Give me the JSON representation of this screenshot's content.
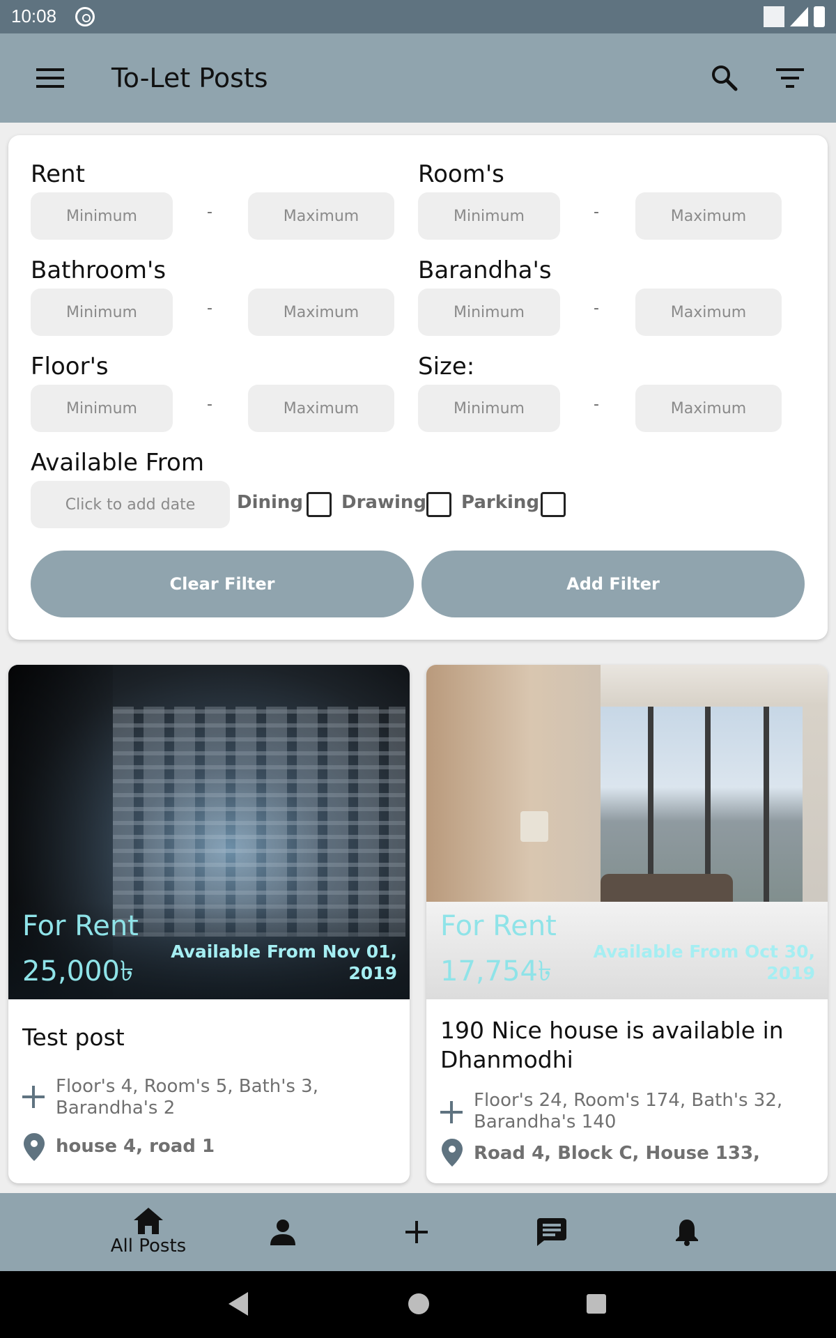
{
  "status_bar": {
    "time": "10:08"
  },
  "app_bar": {
    "title": "To-Let Posts",
    "icons": [
      "menu-icon",
      "search-icon",
      "filter-icon"
    ]
  },
  "filter": {
    "rent": {
      "label": "Rent",
      "min_placeholder": "Minimum",
      "max_placeholder": "Maximum"
    },
    "rooms": {
      "label": "Room's",
      "min_placeholder": "Minimum",
      "max_placeholder": "Maximum"
    },
    "bathrooms": {
      "label": "Bathroom's",
      "min_placeholder": "Minimum",
      "max_placeholder": "Maximum"
    },
    "barandhas": {
      "label": "Barandha's",
      "min_placeholder": "Minimum",
      "max_placeholder": "Maximum"
    },
    "floors": {
      "label": "Floor's",
      "min_placeholder": "Minimum",
      "max_placeholder": "Maximum"
    },
    "size": {
      "label": "Size:",
      "min_placeholder": "Minimum",
      "max_placeholder": "Maximum"
    },
    "dash": "-",
    "available_from": {
      "label": "Available From",
      "placeholder": "Click to add date"
    },
    "checkboxes": {
      "dining": "Dining",
      "drawing": "Drawing",
      "parking": "Parking"
    },
    "clear_label": "Clear Filter",
    "add_label": "Add Filter"
  },
  "posts": [
    {
      "status": "For Rent",
      "price": "25,000৳",
      "available": "Available From Nov 01, 2019",
      "title": "Test post",
      "details": "Floor's 4, Room's 5, Bath's 3, Barandha's 2",
      "address": "house 4, road 1"
    },
    {
      "status": "For Rent",
      "price": "17,754৳",
      "available": "Available From Oct 30, 2019",
      "title": "190 Nice house is available in Dhanmodhi",
      "details": "Floor's 24, Room's 174, Bath's 32, Barandha's 140",
      "address": "Road 4, Block C, House 133,"
    }
  ],
  "bottom_nav": {
    "items": [
      {
        "icon": "home-icon",
        "label": "All Posts"
      },
      {
        "icon": "person-icon"
      },
      {
        "icon": "add-icon"
      },
      {
        "icon": "chat-icon"
      },
      {
        "icon": "bell-icon"
      }
    ]
  },
  "colors": {
    "primary": "#90a4ae",
    "status_bar": "#5f7380",
    "accent_text": "#8fe3e8",
    "card": "#ffffff",
    "background": "#eeeeee"
  }
}
